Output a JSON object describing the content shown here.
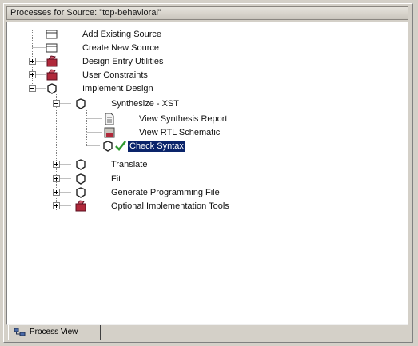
{
  "panel": {
    "title": "Processes for Source: \"top-behavioral\""
  },
  "tree": {
    "add_existing_source": "Add Existing Source",
    "create_new_source": "Create New Source",
    "design_entry_utilities": "Design Entry Utilities",
    "user_constraints": "User Constraints",
    "implement_design": "Implement Design",
    "synthesize": "Synthesize - XST",
    "view_synthesis_report": "View Synthesis Report",
    "view_rtl_schematic": "View RTL Schematic",
    "check_syntax": "Check Syntax",
    "translate": "Translate",
    "fit": "Fit",
    "generate_programming_file": "Generate Programming File",
    "optional_implementation_tools": "Optional Implementation Tools"
  },
  "tabs": {
    "process_view": "Process View"
  },
  "colors": {
    "selection": "#0a246a",
    "success_check": "#2e9a2e",
    "utility_icon": "#b0283a"
  },
  "icons": {
    "source_item": "document-icon",
    "process": "process-cycle-icon",
    "utility": "tools-icon",
    "report": "report-icon",
    "schematic": "schematic-icon",
    "success": "green-check-icon"
  }
}
